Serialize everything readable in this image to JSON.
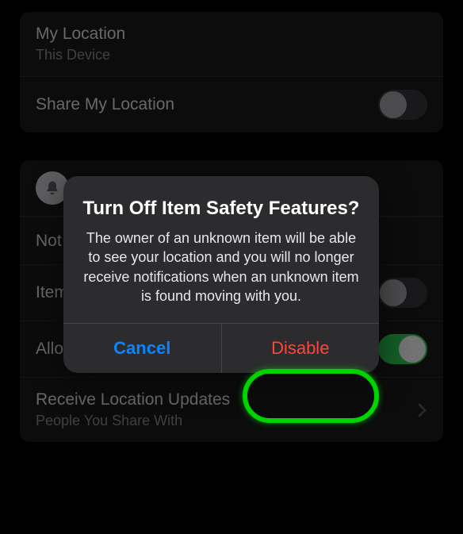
{
  "mylocation": {
    "title": "My Location",
    "sub": "This Device"
  },
  "sharelocation": {
    "label": "Share My Location"
  },
  "notlabel": "Not",
  "item_label": "Item",
  "allow_label": "Allo",
  "receive": {
    "title": "Receive Location Updates",
    "sub": "People You Share With"
  },
  "modal": {
    "title": "Turn Off Item Safety Features?",
    "message": "The owner of an unknown item will be able to see your location and you will no longer receive notifications when an unknown item is found moving with you.",
    "cancel": "Cancel",
    "disable": "Disable"
  }
}
